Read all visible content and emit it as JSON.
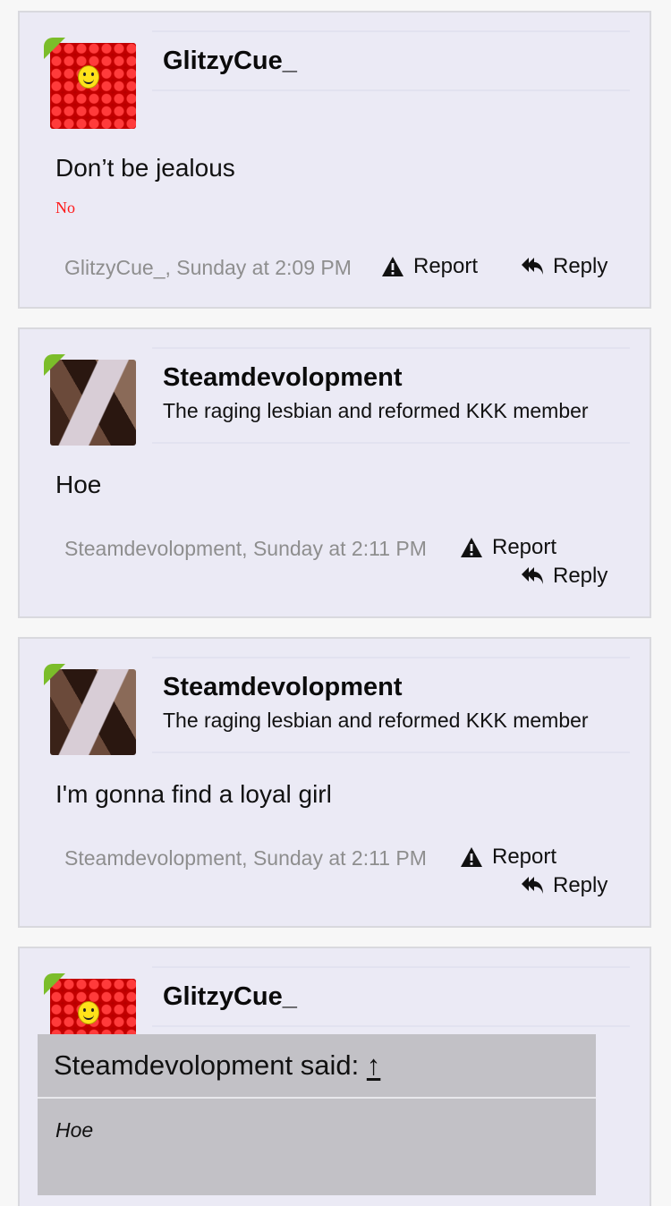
{
  "posts": [
    {
      "username": "GlitzyCue_",
      "user_title": "",
      "message": "Don’t be jealous",
      "signature": "No",
      "meta": "GlitzyCue_, Sunday at 2:09 PM",
      "report_label": "Report",
      "reply_label": "Reply"
    },
    {
      "username": "Steamdevolopment",
      "user_title": "The raging lesbian and reformed KKK member",
      "message": "Hoe",
      "meta": "Steamdevolopment, Sunday at 2:11 PM",
      "report_label": "Report",
      "reply_label": "Reply"
    },
    {
      "username": "Steamdevolopment",
      "user_title": "The raging lesbian and reformed KKK member",
      "message": "I'm gonna find a loyal girl",
      "meta": "Steamdevolopment, Sunday at 2:11 PM",
      "report_label": "Report",
      "reply_label": "Reply"
    },
    {
      "username": "GlitzyCue_",
      "quote": {
        "author_line": "Steamdevolopment said:",
        "arrow": "↑",
        "text": "Hoe"
      }
    }
  ],
  "icons": {
    "report": "warning-triangle-icon",
    "reply": "reply-all-arrow-icon",
    "online": "online-indicator-icon"
  },
  "colors": {
    "post_bg": "#ebeaf5",
    "signature": "#ff1a1a",
    "meta_text": "#8e8e8e",
    "online": "#7bbd2a",
    "quote_bg": "#c2c1c6"
  }
}
